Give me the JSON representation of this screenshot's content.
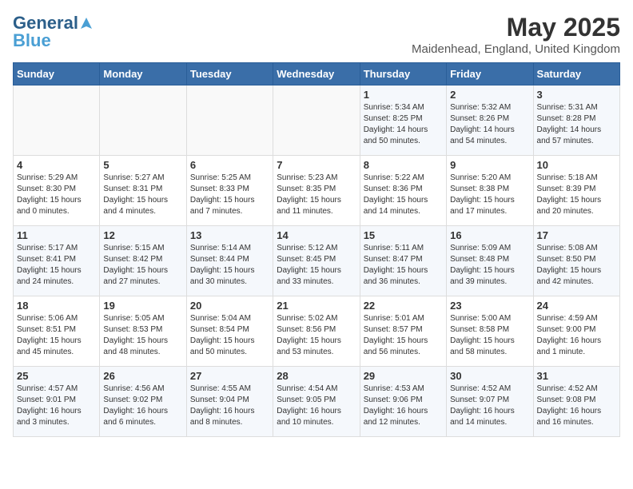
{
  "logo": {
    "general": "General",
    "blue": "Blue"
  },
  "title": "May 2025",
  "location": "Maidenhead, England, United Kingdom",
  "headers": [
    "Sunday",
    "Monday",
    "Tuesday",
    "Wednesday",
    "Thursday",
    "Friday",
    "Saturday"
  ],
  "weeks": [
    [
      {
        "num": "",
        "info": ""
      },
      {
        "num": "",
        "info": ""
      },
      {
        "num": "",
        "info": ""
      },
      {
        "num": "",
        "info": ""
      },
      {
        "num": "1",
        "info": "Sunrise: 5:34 AM\nSunset: 8:25 PM\nDaylight: 14 hours\nand 50 minutes."
      },
      {
        "num": "2",
        "info": "Sunrise: 5:32 AM\nSunset: 8:26 PM\nDaylight: 14 hours\nand 54 minutes."
      },
      {
        "num": "3",
        "info": "Sunrise: 5:31 AM\nSunset: 8:28 PM\nDaylight: 14 hours\nand 57 minutes."
      }
    ],
    [
      {
        "num": "4",
        "info": "Sunrise: 5:29 AM\nSunset: 8:30 PM\nDaylight: 15 hours\nand 0 minutes."
      },
      {
        "num": "5",
        "info": "Sunrise: 5:27 AM\nSunset: 8:31 PM\nDaylight: 15 hours\nand 4 minutes."
      },
      {
        "num": "6",
        "info": "Sunrise: 5:25 AM\nSunset: 8:33 PM\nDaylight: 15 hours\nand 7 minutes."
      },
      {
        "num": "7",
        "info": "Sunrise: 5:23 AM\nSunset: 8:35 PM\nDaylight: 15 hours\nand 11 minutes."
      },
      {
        "num": "8",
        "info": "Sunrise: 5:22 AM\nSunset: 8:36 PM\nDaylight: 15 hours\nand 14 minutes."
      },
      {
        "num": "9",
        "info": "Sunrise: 5:20 AM\nSunset: 8:38 PM\nDaylight: 15 hours\nand 17 minutes."
      },
      {
        "num": "10",
        "info": "Sunrise: 5:18 AM\nSunset: 8:39 PM\nDaylight: 15 hours\nand 20 minutes."
      }
    ],
    [
      {
        "num": "11",
        "info": "Sunrise: 5:17 AM\nSunset: 8:41 PM\nDaylight: 15 hours\nand 24 minutes."
      },
      {
        "num": "12",
        "info": "Sunrise: 5:15 AM\nSunset: 8:42 PM\nDaylight: 15 hours\nand 27 minutes."
      },
      {
        "num": "13",
        "info": "Sunrise: 5:14 AM\nSunset: 8:44 PM\nDaylight: 15 hours\nand 30 minutes."
      },
      {
        "num": "14",
        "info": "Sunrise: 5:12 AM\nSunset: 8:45 PM\nDaylight: 15 hours\nand 33 minutes."
      },
      {
        "num": "15",
        "info": "Sunrise: 5:11 AM\nSunset: 8:47 PM\nDaylight: 15 hours\nand 36 minutes."
      },
      {
        "num": "16",
        "info": "Sunrise: 5:09 AM\nSunset: 8:48 PM\nDaylight: 15 hours\nand 39 minutes."
      },
      {
        "num": "17",
        "info": "Sunrise: 5:08 AM\nSunset: 8:50 PM\nDaylight: 15 hours\nand 42 minutes."
      }
    ],
    [
      {
        "num": "18",
        "info": "Sunrise: 5:06 AM\nSunset: 8:51 PM\nDaylight: 15 hours\nand 45 minutes."
      },
      {
        "num": "19",
        "info": "Sunrise: 5:05 AM\nSunset: 8:53 PM\nDaylight: 15 hours\nand 48 minutes."
      },
      {
        "num": "20",
        "info": "Sunrise: 5:04 AM\nSunset: 8:54 PM\nDaylight: 15 hours\nand 50 minutes."
      },
      {
        "num": "21",
        "info": "Sunrise: 5:02 AM\nSunset: 8:56 PM\nDaylight: 15 hours\nand 53 minutes."
      },
      {
        "num": "22",
        "info": "Sunrise: 5:01 AM\nSunset: 8:57 PM\nDaylight: 15 hours\nand 56 minutes."
      },
      {
        "num": "23",
        "info": "Sunrise: 5:00 AM\nSunset: 8:58 PM\nDaylight: 15 hours\nand 58 minutes."
      },
      {
        "num": "24",
        "info": "Sunrise: 4:59 AM\nSunset: 9:00 PM\nDaylight: 16 hours\nand 1 minute."
      }
    ],
    [
      {
        "num": "25",
        "info": "Sunrise: 4:57 AM\nSunset: 9:01 PM\nDaylight: 16 hours\nand 3 minutes."
      },
      {
        "num": "26",
        "info": "Sunrise: 4:56 AM\nSunset: 9:02 PM\nDaylight: 16 hours\nand 6 minutes."
      },
      {
        "num": "27",
        "info": "Sunrise: 4:55 AM\nSunset: 9:04 PM\nDaylight: 16 hours\nand 8 minutes."
      },
      {
        "num": "28",
        "info": "Sunrise: 4:54 AM\nSunset: 9:05 PM\nDaylight: 16 hours\nand 10 minutes."
      },
      {
        "num": "29",
        "info": "Sunrise: 4:53 AM\nSunset: 9:06 PM\nDaylight: 16 hours\nand 12 minutes."
      },
      {
        "num": "30",
        "info": "Sunrise: 4:52 AM\nSunset: 9:07 PM\nDaylight: 16 hours\nand 14 minutes."
      },
      {
        "num": "31",
        "info": "Sunrise: 4:52 AM\nSunset: 9:08 PM\nDaylight: 16 hours\nand 16 minutes."
      }
    ]
  ]
}
